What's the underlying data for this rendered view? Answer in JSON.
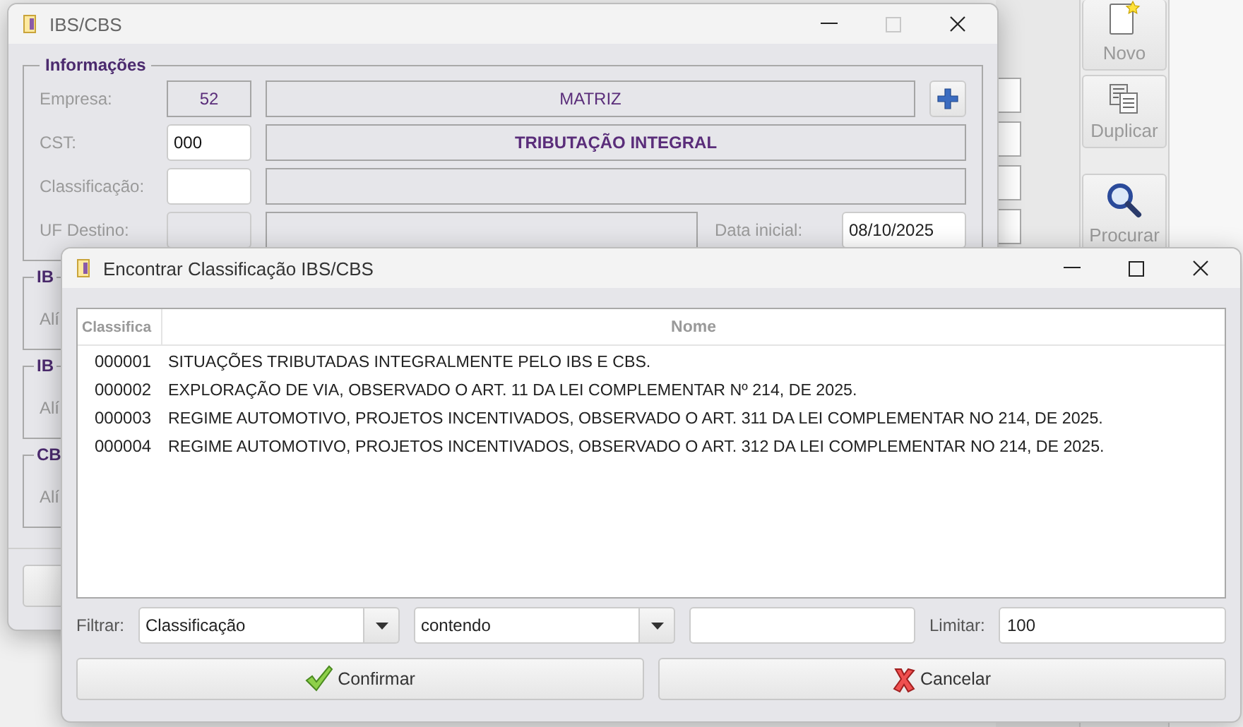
{
  "background_app": {
    "toolbar": [
      {
        "label": "Novo",
        "kind": "new"
      },
      {
        "label": "Duplicar",
        "kind": "duplicate"
      },
      {
        "label": "Procurar",
        "kind": "search"
      }
    ]
  },
  "main_window": {
    "title": "IBS/CBS",
    "maximize_disabled": true,
    "info_group": {
      "title": "Informações",
      "rows": [
        {
          "kind": "lookup",
          "label": "Empresa:",
          "code": "52",
          "code_disabled": true,
          "name": "MATRIZ",
          "name_bold": false
        },
        {
          "kind": "plain",
          "label": "CST:",
          "code": "000",
          "code_disabled": false,
          "name": "TRIBUTAÇÃO INTEGRAL",
          "name_bold": true
        },
        {
          "kind": "plain",
          "label": "Classificação:",
          "code_disabled": false
        },
        {
          "kind": "dated",
          "label": "UF Destino:",
          "code_disabled": true,
          "date_label": "Data inicial:",
          "date": "08/10/2025"
        }
      ]
    },
    "tax_groups": [
      {
        "title": "IB",
        "rate_label": "Alí"
      },
      {
        "title": "IB",
        "rate_label": "Alí"
      },
      {
        "title": "CB",
        "rate_label": "Alí"
      }
    ]
  },
  "dialog": {
    "title": "Encontrar Classificação IBS/CBS",
    "maximize_disabled": false,
    "table": {
      "columns": [
        "Classifica",
        "Nome"
      ],
      "rows": [
        {
          "code": "000001",
          "name": "SITUAÇÕES TRIBUTADAS INTEGRALMENTE PELO IBS E CBS."
        },
        {
          "code": "000002",
          "name": "EXPLORAÇÃO DE VIA, OBSERVADO O ART. 11 DA LEI COMPLEMENTAR Nº 214, DE 2025."
        },
        {
          "code": "000003",
          "name": "REGIME AUTOMOTIVO, PROJETOS INCENTIVADOS, OBSERVADO O ART. 311 DA LEI COMPLEMENTAR NO 214, DE 2025."
        },
        {
          "code": "000004",
          "name": "REGIME AUTOMOTIVO, PROJETOS INCENTIVADOS, OBSERVADO O ART. 312 DA LEI COMPLEMENTAR NO 214, DE 2025."
        }
      ]
    },
    "filter": {
      "label": "Filtrar:",
      "field": "Classificação",
      "operator": "contendo",
      "limit_label": "Limitar:",
      "limit": "100"
    },
    "buttons": [
      {
        "label": "Confirmar",
        "kind": "confirm"
      },
      {
        "label": "Cancelar",
        "kind": "cancel"
      }
    ]
  }
}
